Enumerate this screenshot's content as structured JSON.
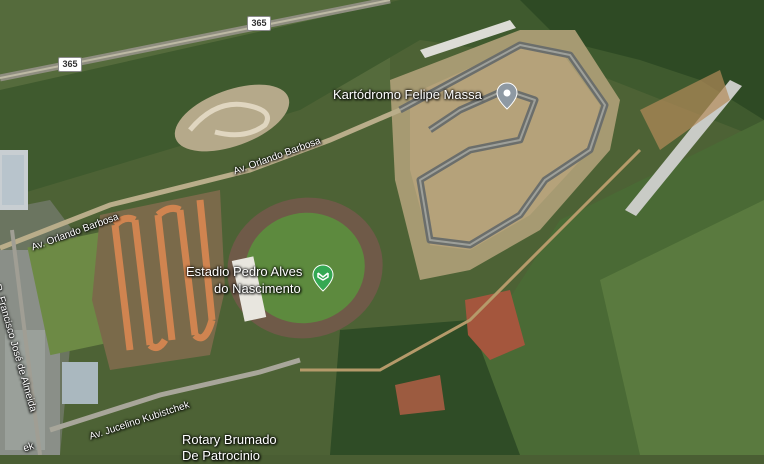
{
  "map": {
    "type": "satellite",
    "places": [
      {
        "name": "Kartódromo Felipe Massa",
        "category": "racetrack"
      },
      {
        "name": "Estadio Pedro Alves do Nascimento",
        "category": "stadium"
      }
    ],
    "place_label_lines": {
      "kart": "Kartódromo Felipe Massa",
      "stadium_line1": "Estadio Pedro Alves",
      "stadium_line2": "do Nascimento",
      "rotary_line1": "Rotary Brumado",
      "rotary_line2": "De Patrocinio"
    },
    "roads": {
      "highway_shield": "365",
      "orlando_1": "Av. Orlando Barbosa",
      "orlando_2": "Av. Orlando Barbosa",
      "jucelino": "Av. Jucelino Kubistchek",
      "francisco": "R. Francisco José de Almeida",
      "partial_left": "ek"
    },
    "icons": {
      "kart_pin": "place-pin-icon",
      "stadium_pin": "stadium-pin-icon"
    },
    "colors": {
      "pin_gray": "#8e99a3",
      "pin_green": "#34a853",
      "label": "#ffffff"
    }
  }
}
